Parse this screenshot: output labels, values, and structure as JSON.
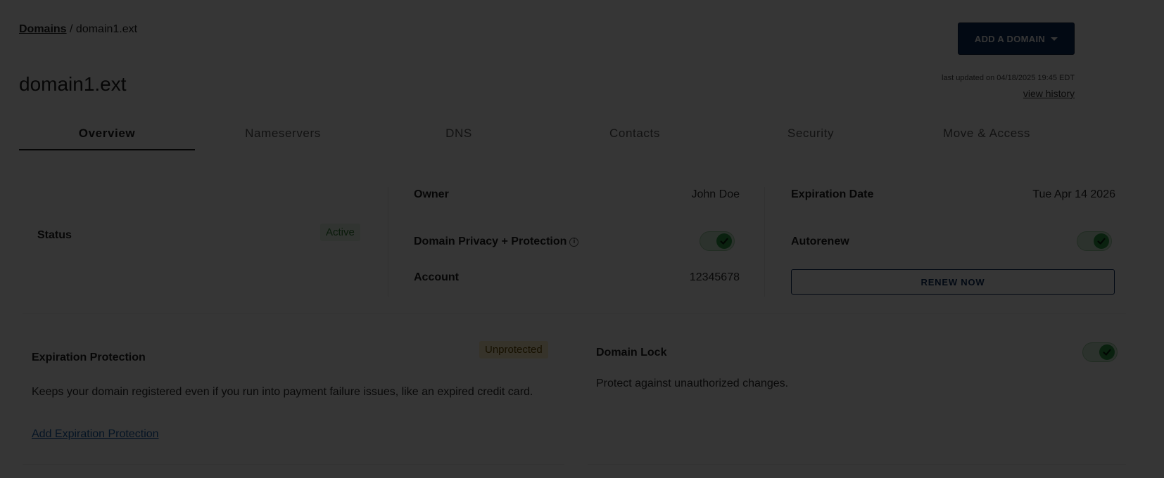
{
  "breadcrumb": {
    "link": "Domains",
    "separator": " / ",
    "current": "domain1.ext"
  },
  "header": {
    "title": "domain1.ext",
    "add_button": "ADD A DOMAIN",
    "last_updated": "last updated on 04/18/2025 19:45 EDT",
    "history_link": "view history"
  },
  "tabs": [
    {
      "label": "Overview",
      "active": true
    },
    {
      "label": "Nameservers"
    },
    {
      "label": "DNS"
    },
    {
      "label": "Contacts"
    },
    {
      "label": "Security"
    },
    {
      "label": "Move & Access"
    }
  ],
  "summary": {
    "status_label": "Status",
    "status_value": "Active",
    "owner_label": "Owner",
    "owner_value": "John Doe",
    "privacy_label": "Domain Privacy + Protection",
    "privacy_on": true,
    "account_label": "Account",
    "account_value": "12345678",
    "expiration_label": "Expiration Date",
    "expiration_value": "Tue Apr 14 2026",
    "autorenew_label": "Autorenew",
    "autorenew_on": true,
    "renew_button": "RENEW NOW"
  },
  "expiration_protection": {
    "title": "Expiration Protection",
    "badge": "Unprotected",
    "description": "Keeps your domain registered even if you run into payment failure issues, like an expired credit card.",
    "link": "Add Expiration Protection"
  },
  "domain_lock": {
    "title": "Domain Lock",
    "enabled": true,
    "description": "Protect against unauthorized changes."
  },
  "colors": {
    "primary": "#0b2a5c",
    "success": "#2f9e4a",
    "warning": "#fff1c4"
  },
  "icons": [
    "chevron-down-icon",
    "info-icon",
    "check-icon"
  ]
}
